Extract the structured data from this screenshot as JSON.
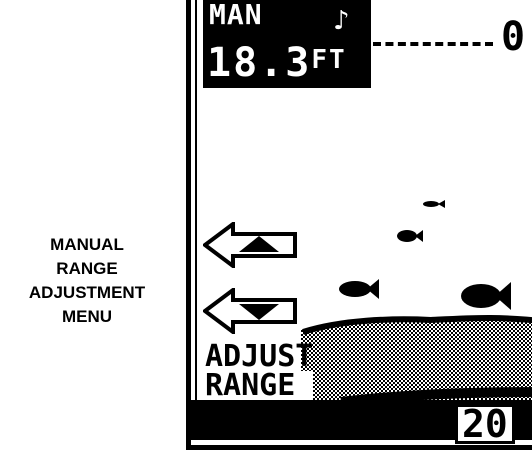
{
  "caption": {
    "lines": [
      "MANUAL",
      "RANGE",
      "ADJUSTMENT",
      "MENU"
    ]
  },
  "display": {
    "mode": "MAN",
    "mode_icon": "signal-icon",
    "depth_value": "18.3",
    "depth_unit": "FT",
    "range_top": "0",
    "range_bottom": "20"
  },
  "menu": {
    "up_button_icon": "arrow-left-up-icon",
    "down_button_icon": "arrow-left-down-icon",
    "adjust_line1": "ADJUST",
    "adjust_line2": "RANGE"
  }
}
